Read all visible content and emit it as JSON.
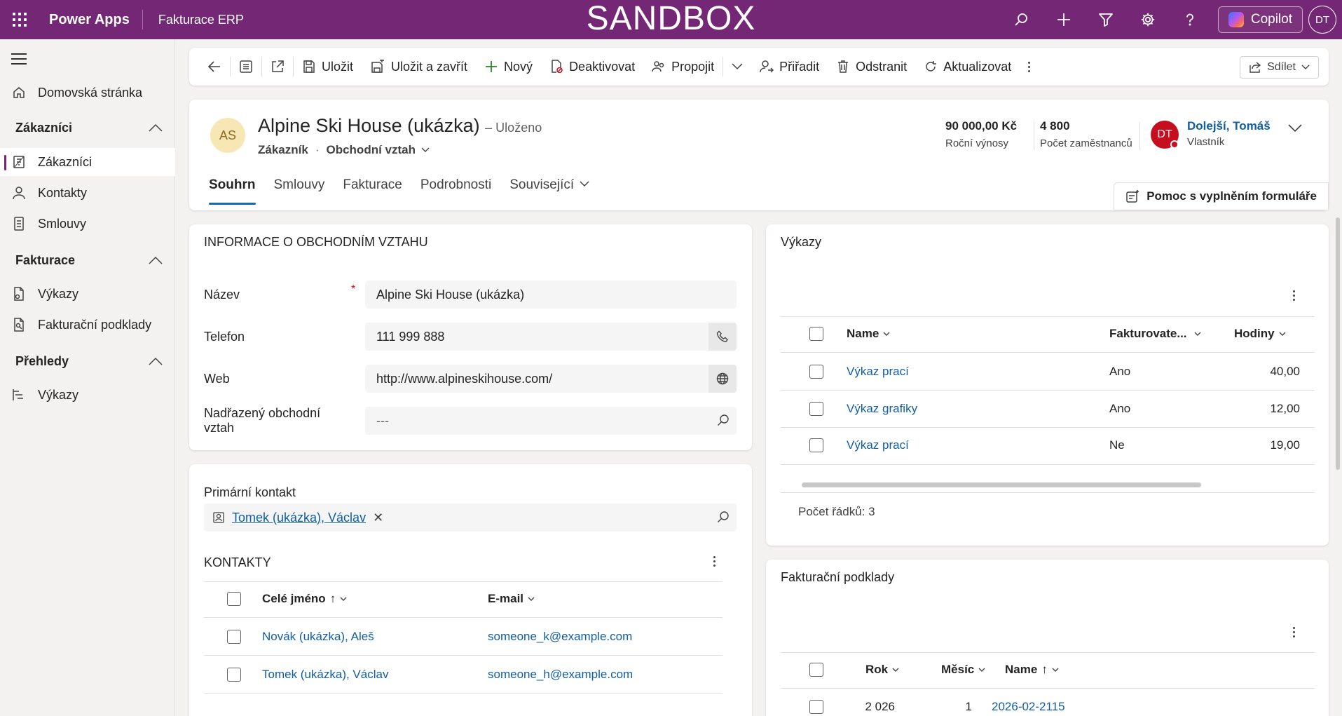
{
  "topbar": {
    "app_name": "Power Apps",
    "environment": "Fakturace ERP",
    "banner": "SANDBOX",
    "copilot_label": "Copilot",
    "user_initials": "DT",
    "brand_color": "#742774"
  },
  "sidebar": {
    "home": "Domovská stránka",
    "groups": [
      {
        "label": "Zákazníci",
        "items": [
          "Zákazníci",
          "Kontakty",
          "Smlouvy"
        ]
      },
      {
        "label": "Fakturace",
        "items": [
          "Výkazy",
          "Fakturační podklady"
        ]
      },
      {
        "label": "Přehledy",
        "items": [
          "Výkazy"
        ]
      }
    ],
    "selected": "Zákazníci"
  },
  "commandbar": {
    "save": "Uložit",
    "save_close": "Uložit a zavřít",
    "new": "Nový",
    "deactivate": "Deaktivovat",
    "connect": "Propojit",
    "assign": "Přiřadit",
    "delete": "Odstranit",
    "refresh": "Aktualizovat",
    "share": "Sdílet"
  },
  "record": {
    "initials": "AS",
    "title": "Alpine Ski House (ukázka)",
    "status": "– Uloženo",
    "entity": "Zákazník",
    "form": "Obchodní vztah",
    "annual_revenue": "90 000,00 Kč",
    "annual_revenue_label": "Roční výnosy",
    "employees": "4 800",
    "employees_label": "Počet zaměstnanců",
    "owner_initials": "DT",
    "owner_name": "Dolejší, Tomáš",
    "owner_label": "Vlastník",
    "tabs": [
      "Souhrn",
      "Smlouvy",
      "Fakturace",
      "Podrobnosti",
      "Související"
    ],
    "assist": "Pomoc s vyplněním formuláře"
  },
  "info": {
    "section_title": "INFORMACE O OBCHODNÍM VZTAHU",
    "name_label": "Název",
    "name_value": "Alpine Ski House (ukázka)",
    "phone_label": "Telefon",
    "phone_value": "111 999 888",
    "web_label": "Web",
    "web_value": "http://www.alpineskihouse.com/",
    "parent_label": "Nadřazený obchodní vztah",
    "parent_value": "---"
  },
  "contacts": {
    "primary_label": "Primární kontakt",
    "primary_value": "Tomek (ukázka), Václav",
    "section_title": "KONTAKTY",
    "col_name": "Celé jméno",
    "col_email": "E-mail",
    "rows": [
      {
        "name": "Novák (ukázka), Aleš",
        "email": "someone_k@example.com"
      },
      {
        "name": "Tomek (ukázka), Václav",
        "email": "someone_h@example.com"
      }
    ]
  },
  "timesheets": {
    "title": "Výkazy",
    "col_name": "Name",
    "col_billable": "Fakturovate...",
    "col_hours": "Hodiny",
    "rows": [
      {
        "name": "Výkaz prací",
        "billable": "Ano",
        "hours": "40,00"
      },
      {
        "name": "Výkaz grafiky",
        "billable": "Ano",
        "hours": "12,00"
      },
      {
        "name": "Výkaz prací",
        "billable": "Ne",
        "hours": "19,00"
      }
    ],
    "row_count": "Počet řádků: 3"
  },
  "billing": {
    "title": "Fakturační podklady",
    "col_year": "Rok",
    "col_month": "Měsíc",
    "col_name": "Name",
    "rows": [
      {
        "year": "2 026",
        "month": "1",
        "name": "2026-02-2115"
      }
    ]
  }
}
